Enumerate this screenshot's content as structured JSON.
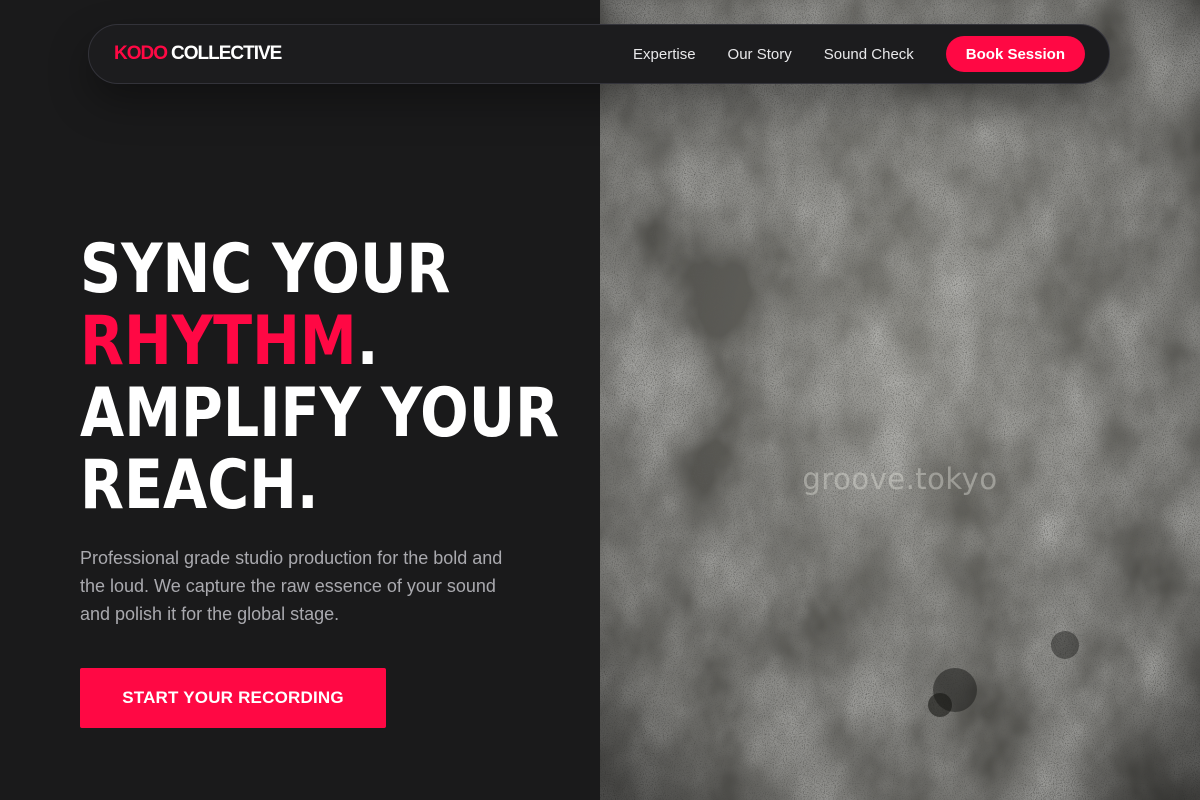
{
  "brand": {
    "accent_word": "KODO",
    "rest_word": "COLLECTIVE"
  },
  "nav": {
    "links": [
      {
        "label": "Expertise"
      },
      {
        "label": "Our Story"
      },
      {
        "label": "Sound Check"
      }
    ],
    "cta_label": "Book Session"
  },
  "hero": {
    "headline": {
      "line1": "SYNC YOUR",
      "line2_accent": "RHYTHM",
      "line2_punct": ".",
      "line3": "AMPLIFY YOUR",
      "line4": "REACH."
    },
    "subtext": "Professional grade studio production for the bold and the loud. We capture the raw essence of your sound and polish it for the global stage.",
    "cta_label": "START YOUR RECORDING"
  },
  "image": {
    "watermark": "groove.tokyo"
  },
  "colors": {
    "accent": "#ff0844",
    "background": "#1a1a1b",
    "text": "#ffffff",
    "muted_text": "#a9a9ae"
  }
}
